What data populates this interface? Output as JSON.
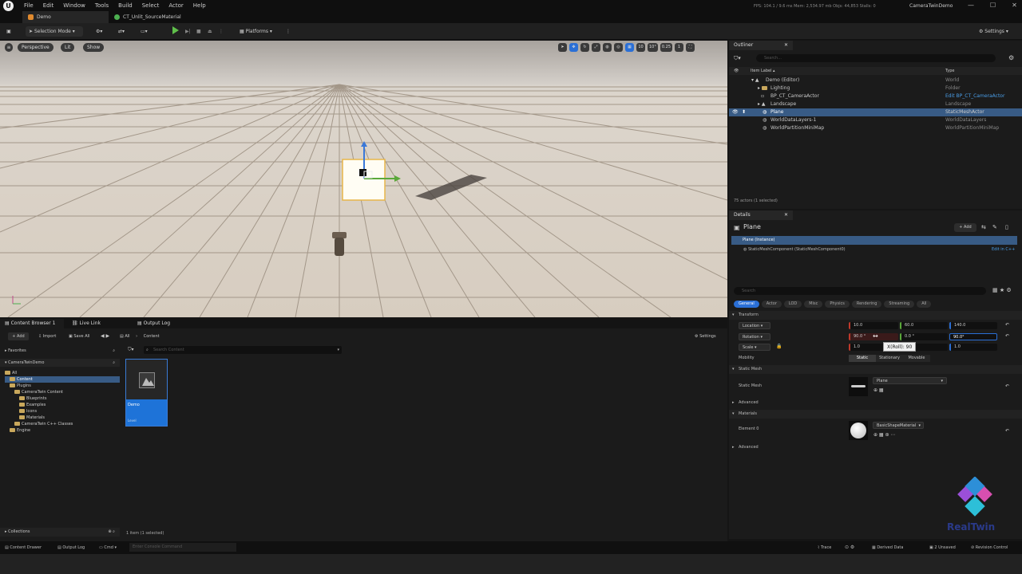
{
  "menubar": {
    "logo": "U",
    "menus": [
      "File",
      "Edit",
      "Window",
      "Tools",
      "Build",
      "Select",
      "Actor",
      "Help"
    ],
    "stats": "FPS: 104.1 / 9.6 ms   Mem: 2,534.97 mb   Objs: 44,853   Stalls: 0",
    "project": "CameraTwinDemo",
    "window_buttons": [
      "—",
      "☐",
      "✕"
    ]
  },
  "tabs": [
    {
      "label": "Demo",
      "color": "#e08a2e"
    },
    {
      "label": "CT_Unlit_SourceMaterial",
      "color": "#4caf50"
    }
  ],
  "toolbar": {
    "selection_mode": "Selection Mode",
    "platforms": "Platforms",
    "settings": "Settings"
  },
  "viewport": {
    "perspective": "Perspective",
    "lit": "Lit",
    "show": "Show",
    "grid_snap": "10",
    "angle_snap": "10°",
    "scale_snap": "0.25",
    "camera_speed": "1"
  },
  "outliner": {
    "tab": "Outliner",
    "search_placeholder": "Search...",
    "col_label": "Item Label ▴",
    "col_type": "Type",
    "rows": [
      {
        "label": "Demo (Editor)",
        "type": "World"
      },
      {
        "label": "Lighting",
        "type": "Folder"
      },
      {
        "label": "BP_CT_CameraActor",
        "type": "Edit BP_CT_CameraActor"
      },
      {
        "label": "Landscape",
        "type": "Landscape"
      },
      {
        "label": "Plane",
        "type": "StaticMeshActor"
      },
      {
        "label": "WorldDataLayers-1",
        "type": "WorldDataLayers"
      },
      {
        "label": "WorldPartitionMiniMap",
        "type": "WorldPartitionMiniMap"
      }
    ],
    "footer": "75 actors (1 selected)"
  },
  "details": {
    "tab": "Details",
    "actor_name": "Plane",
    "add_label": "+ Add",
    "instance": "Plane (Instance)",
    "component": "StaticMeshComponent (StaticMeshComponent0)",
    "edit_cpp": "Edit in C++",
    "search_placeholder": "Search",
    "categories": [
      "General",
      "Actor",
      "LOD",
      "Misc",
      "Physics",
      "Rendering",
      "Streaming",
      "All"
    ],
    "transform": "Transform",
    "location_label": "Location",
    "rotation_label": "Rotation",
    "scale_label": "Scale",
    "location": [
      "10.0",
      "60.0",
      "140.0"
    ],
    "rotation": [
      "90.0 °",
      "0.0 °",
      "90.0°"
    ],
    "scale": [
      "1.0",
      "1.0",
      "1.0"
    ],
    "tooltip": "X(Roll): 90",
    "mobility_label": "Mobility",
    "mobility_options": [
      "Static",
      "Stationary",
      "Movable"
    ],
    "static_mesh_section": "Static Mesh",
    "static_mesh_label": "Static Mesh",
    "static_mesh_value": "Plane",
    "advanced": "Advanced",
    "materials_section": "Materials",
    "element0_label": "Element 0",
    "material_value": "BasicShapeMaterial"
  },
  "content": {
    "tab_content_browser": "Content Browser 1",
    "tab_live_link": "Live Link",
    "tab_output_log": "Output Log",
    "add": "+ Add",
    "import": "Import",
    "save_all": "Save All",
    "breadcrumb": [
      "All",
      "Content"
    ],
    "settings": "Settings",
    "favorites": "Favorites",
    "project_root": "CameraTwinDemo",
    "search_placeholder": "Search Content",
    "tree": [
      {
        "label": "All",
        "indent": 0
      },
      {
        "label": "Content",
        "indent": 1
      },
      {
        "label": "Plugins",
        "indent": 1
      },
      {
        "label": "CameraTwin Content",
        "indent": 2
      },
      {
        "label": "Blueprints",
        "indent": 3
      },
      {
        "label": "Examples",
        "indent": 3
      },
      {
        "label": "Icons",
        "indent": 3
      },
      {
        "label": "Materials",
        "indent": 3
      },
      {
        "label": "CameraTwin C++ Classes",
        "indent": 2
      },
      {
        "label": "Engine",
        "indent": 1
      }
    ],
    "asset_name": "Demo",
    "asset_type": "Level",
    "collections": "Collections",
    "item_count": "1 item (1 selected)"
  },
  "statusbar": {
    "content_drawer": "Content Drawer",
    "output_log": "Output Log",
    "cmd": "Cmd",
    "console_placeholder": "Enter Console Command",
    "trace": "Trace",
    "derived_data": "Derived Data",
    "unsaved": "2 Unsaved",
    "revision_control": "Revision Control"
  },
  "watermark": "RealTwin"
}
